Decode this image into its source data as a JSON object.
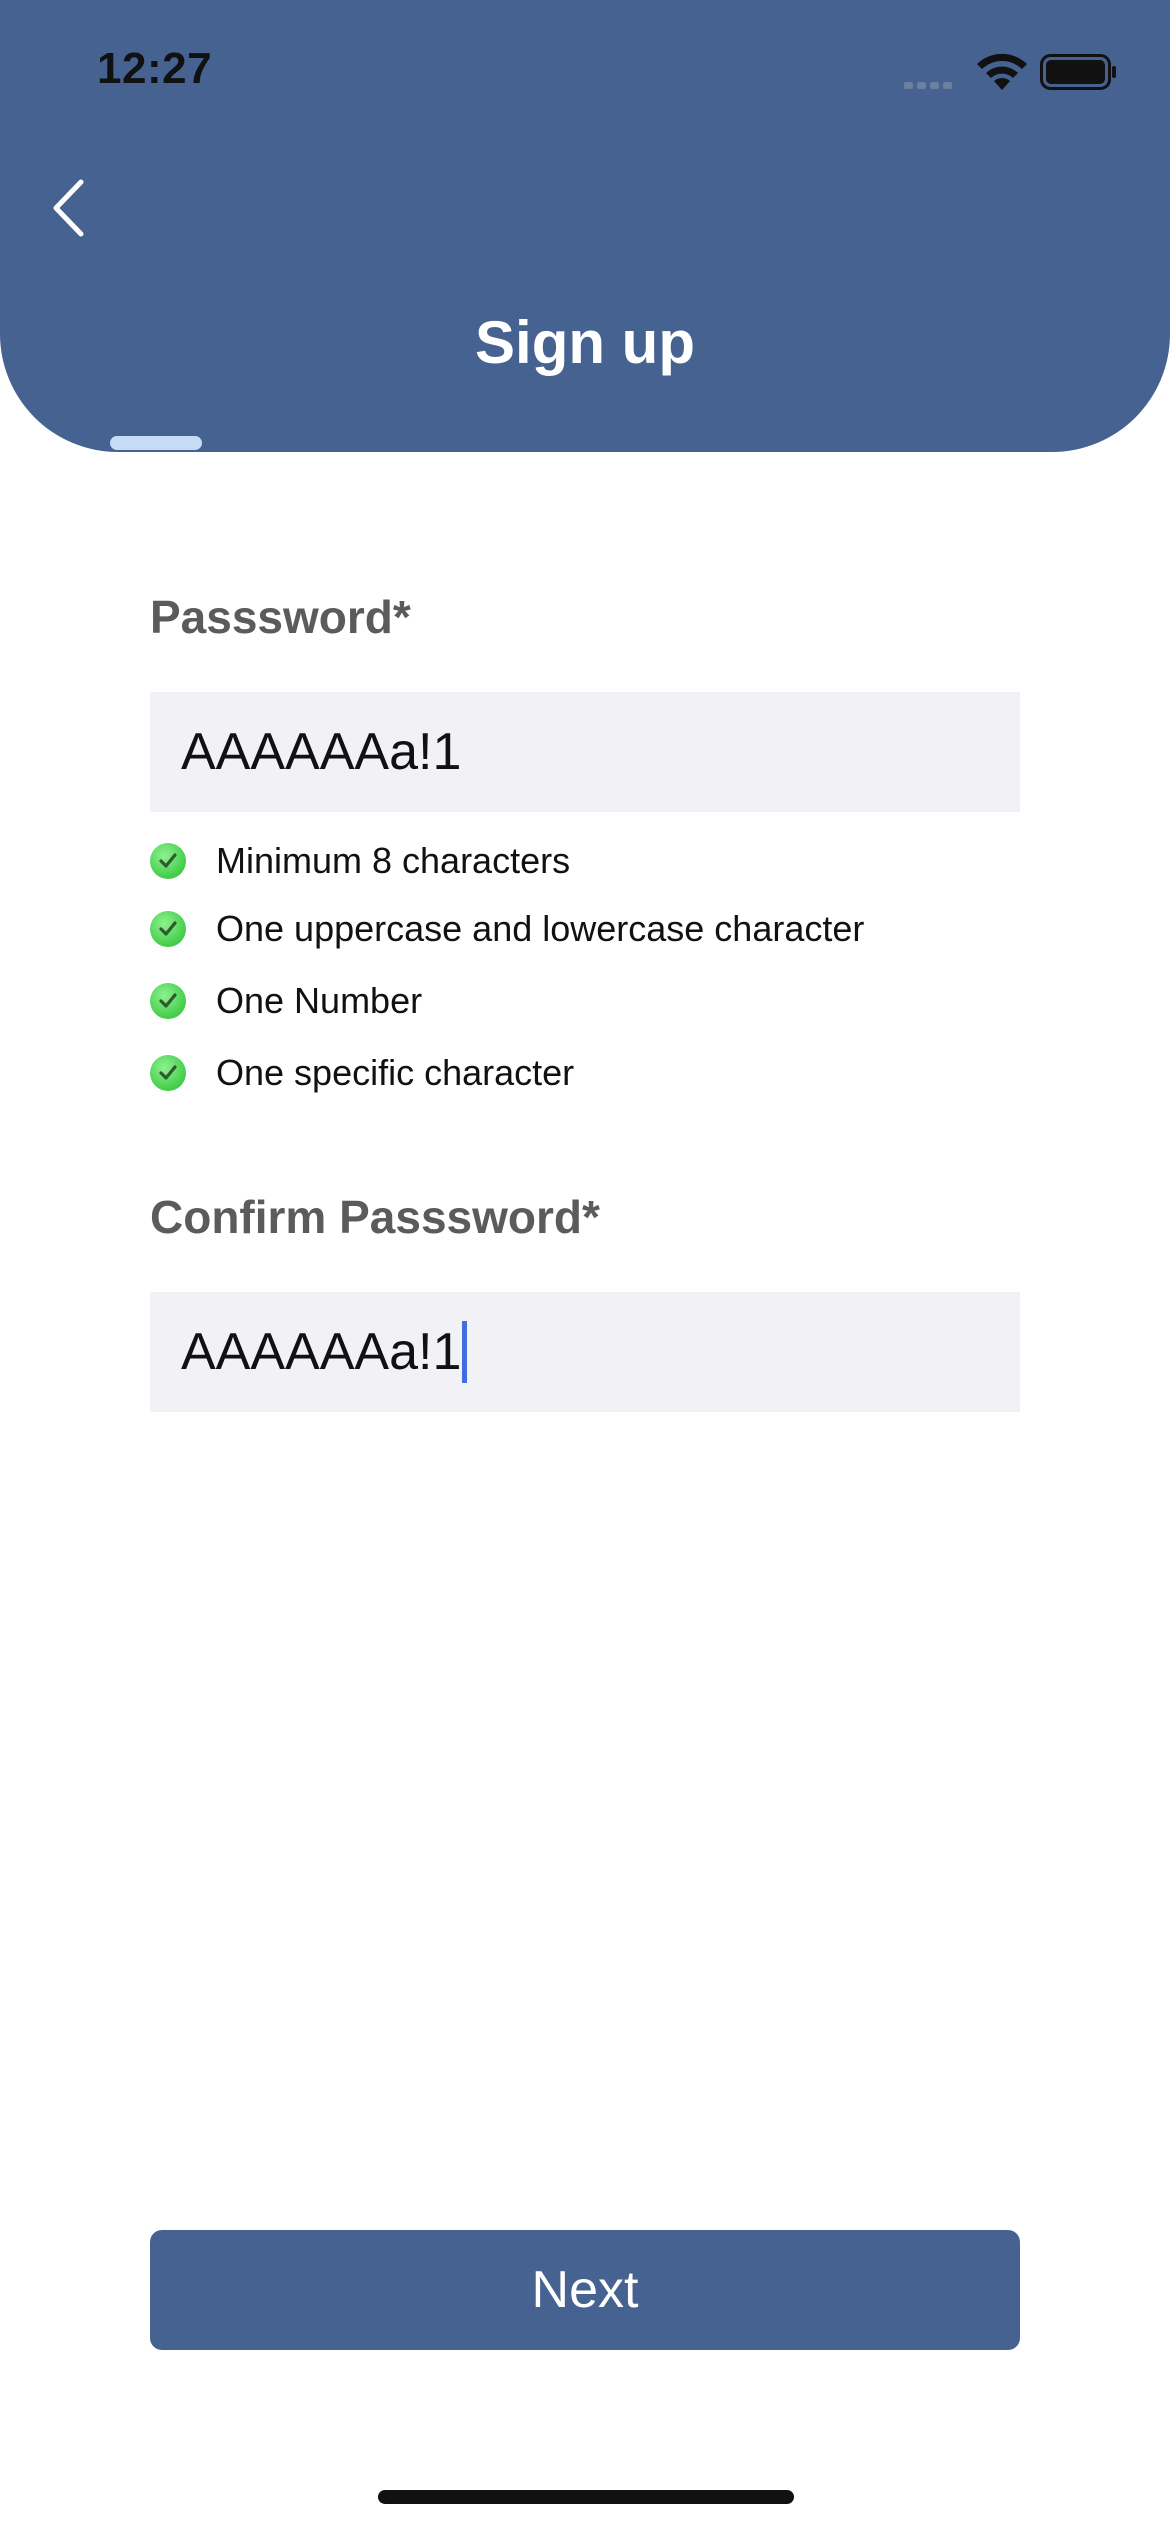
{
  "status_bar": {
    "time": "12:27"
  },
  "header": {
    "title": "Sign up",
    "back_icon": "chevron-left-icon"
  },
  "form": {
    "password": {
      "label": "Passsword*",
      "value": "AAAAAAa!1"
    },
    "rules": [
      {
        "text": "Minimum 8 characters",
        "met": true
      },
      {
        "text": "One uppercase and lowercase character",
        "met": true
      },
      {
        "text": "One Number",
        "met": true
      },
      {
        "text": "One specific character",
        "met": true
      }
    ],
    "confirm_password": {
      "label": "Confirm Passsword*",
      "value": "AAAAAAa!1"
    }
  },
  "actions": {
    "next_label": "Next"
  },
  "colors": {
    "header": "#456290",
    "button": "#456290",
    "input_bg": "#f1f1f6",
    "check": "#43cd4a",
    "caret": "#3f6ee0"
  }
}
